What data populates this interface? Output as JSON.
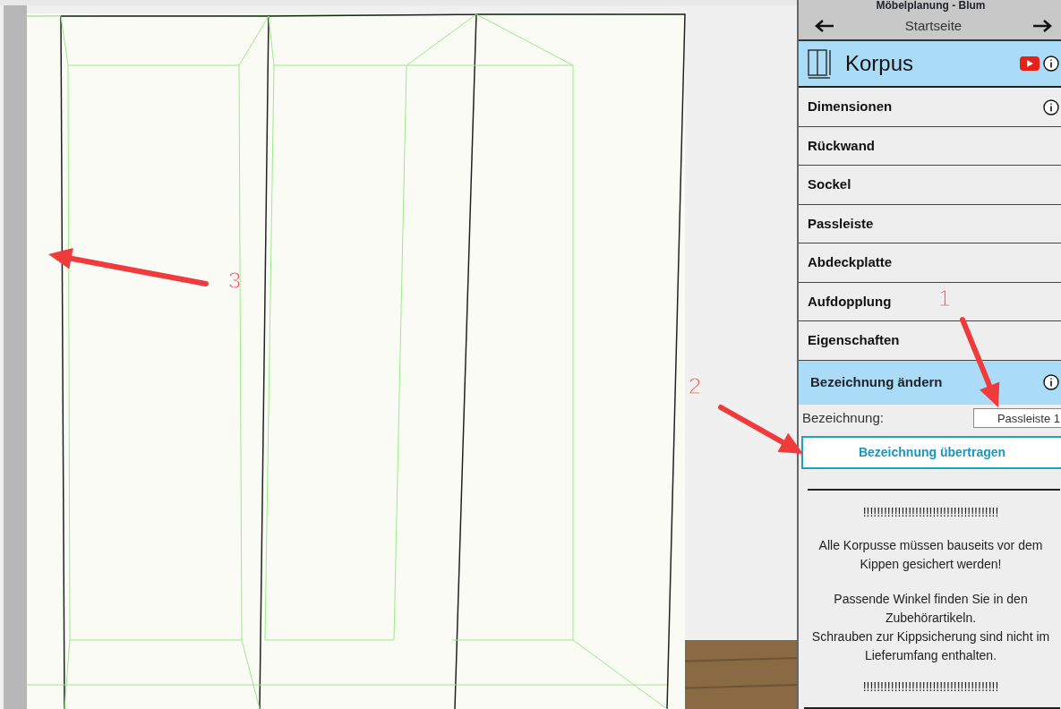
{
  "window": {
    "title": "Möbelplanung - Blum"
  },
  "nav": {
    "label": "Startseite"
  },
  "section": {
    "title": "Korpus"
  },
  "menu": [
    {
      "label": "Dimensionen",
      "info": true
    },
    {
      "label": "Rückwand",
      "info": false
    },
    {
      "label": "Sockel",
      "info": false
    },
    {
      "label": "Passleiste",
      "info": false
    },
    {
      "label": "Abdeckplatte",
      "info": false
    },
    {
      "label": "Aufdopplung",
      "info": false
    },
    {
      "label": "Eigenschaften",
      "info": false
    }
  ],
  "edit": {
    "title": "Bezeichnung ändern",
    "info": true,
    "field_label": "Bezeichnung:",
    "value": "Passleiste 1",
    "button": "Bezeichnung übertragen"
  },
  "notice": [
    "!!!!!!!!!!!!!!!!!!!!!!!!!!!!!!!!!!!!!!!",
    "Alle Korpusse müssen bauseits vor dem Kippen gesichert werden!",
    "Passende Winkel finden Sie in den Zubehörartikeln.",
    "Schrauben zur Kippsicherung sind nicht im Lieferumfang enthalten.",
    "!!!!!!!!!!!!!!!!!!!!!!!!!!!!!!!!!!!!!!!"
  ],
  "annotations": [
    {
      "label": "1"
    },
    {
      "label": "2"
    },
    {
      "label": "3"
    }
  ]
}
